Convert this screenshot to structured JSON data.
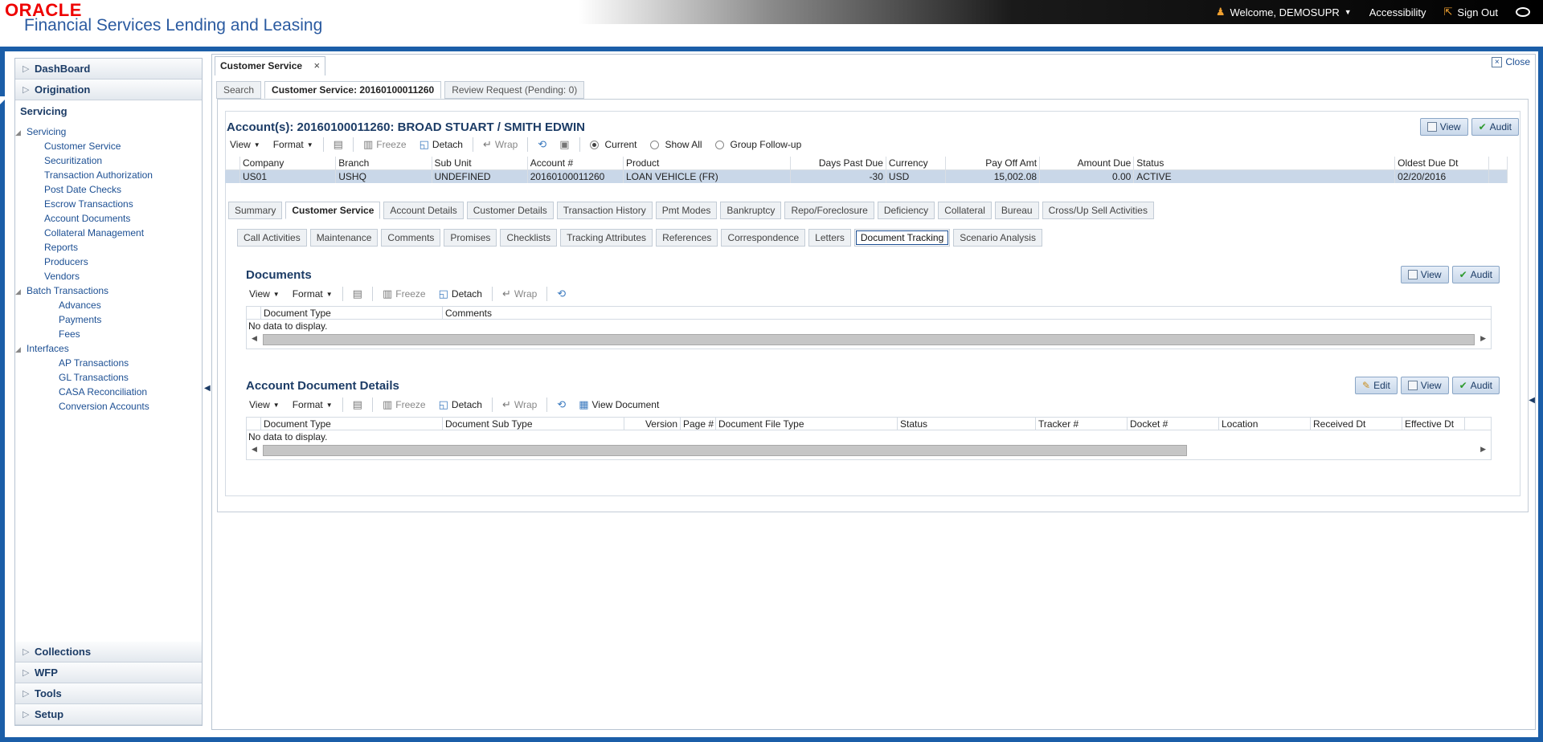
{
  "header": {
    "brand": "ORACLE",
    "product": "Financial Services Lending and Leasing",
    "welcome": "Welcome, DEMOSUPR",
    "accessibility": "Accessibility",
    "signout": "Sign Out"
  },
  "sidebar": {
    "top": [
      {
        "label": "DashBoard"
      },
      {
        "label": "Origination"
      }
    ],
    "open": "Servicing",
    "tree": [
      {
        "label": "Servicing",
        "level": 1,
        "twisty": "◢"
      },
      {
        "label": "Customer Service",
        "level": 2
      },
      {
        "label": "Securitization",
        "level": 2
      },
      {
        "label": "Transaction Authorization",
        "level": 2
      },
      {
        "label": "Post Date Checks",
        "level": 2
      },
      {
        "label": "Escrow Transactions",
        "level": 2
      },
      {
        "label": "Account Documents",
        "level": 2
      },
      {
        "label": "Collateral Management",
        "level": 2
      },
      {
        "label": "Reports",
        "level": 2
      },
      {
        "label": "Producers",
        "level": 2
      },
      {
        "label": "Vendors",
        "level": 2
      },
      {
        "label": "Batch Transactions",
        "level": 2,
        "twisty": "◢"
      },
      {
        "label": "Advances",
        "level": 3
      },
      {
        "label": "Payments",
        "level": 3
      },
      {
        "label": "Fees",
        "level": 3
      },
      {
        "label": "Interfaces",
        "level": 2,
        "twisty": "◢"
      },
      {
        "label": "AP Transactions",
        "level": 3
      },
      {
        "label": "GL Transactions",
        "level": 3
      },
      {
        "label": "CASA Reconciliation",
        "level": 3
      },
      {
        "label": "Conversion Accounts",
        "level": 3
      }
    ],
    "bottom": [
      {
        "label": "Collections"
      },
      {
        "label": "WFP"
      },
      {
        "label": "Tools"
      },
      {
        "label": "Setup"
      }
    ]
  },
  "main": {
    "doc_tab": "Customer Service",
    "close": "Close",
    "subtabs": [
      "Search",
      "Customer Service: 20160100011260",
      "Review Request (Pending: 0)"
    ],
    "account_title": "Account(s): 20160100011260: BROAD STUART / SMITH EDWIN",
    "toolbar": {
      "view": "View",
      "format": "Format",
      "freeze": "Freeze",
      "detach": "Detach",
      "wrap": "Wrap",
      "current": "Current",
      "show_all": "Show All",
      "group_followup": "Group Follow-up"
    },
    "buttons": {
      "view": "View",
      "audit": "Audit",
      "edit": "Edit"
    },
    "account_columns": [
      "Company",
      "Branch",
      "Sub Unit",
      "Account #",
      "Product",
      "Days Past Due",
      "Currency",
      "Pay Off Amt",
      "Amount Due",
      "Status",
      "Oldest Due Dt"
    ],
    "account_row": [
      "US01",
      "USHQ",
      "UNDEFINED",
      "20160100011260",
      "LOAN VEHICLE (FR)",
      "-30",
      "USD",
      "15,002.08",
      "0.00",
      "ACTIVE",
      "02/20/2016"
    ],
    "content_tabs": [
      "Summary",
      "Customer Service",
      "Account Details",
      "Customer Details",
      "Transaction History",
      "Pmt Modes",
      "Bankruptcy",
      "Repo/Foreclosure",
      "Deficiency",
      "Collateral",
      "Bureau",
      "Cross/Up Sell Activities"
    ],
    "cs_tabs": [
      "Call Activities",
      "Maintenance",
      "Comments",
      "Promises",
      "Checklists",
      "Tracking Attributes",
      "References",
      "Correspondence",
      "Letters",
      "Document Tracking",
      "Scenario Analysis"
    ],
    "documents": {
      "title": "Documents",
      "columns": [
        "Document Type",
        "Comments"
      ],
      "empty": "No data to display."
    },
    "details": {
      "title": "Account Document Details",
      "view_document": "View Document",
      "columns": [
        "Document Type",
        "Document Sub Type",
        "Version",
        "Page #",
        "Document File Type",
        "Status",
        "Tracker #",
        "Docket #",
        "Location",
        "Received Dt",
        "Effective Dt"
      ],
      "empty": "No data to display."
    }
  }
}
